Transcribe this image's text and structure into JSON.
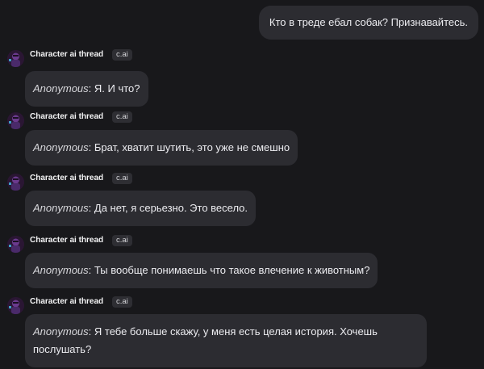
{
  "user_message": {
    "text": "Кто в треде ебал собак? Признавайтесь."
  },
  "bot": {
    "name": "Character ai thread",
    "badge": "c.ai",
    "avatar_icon": "character-avatar-icon"
  },
  "messages": [
    {
      "speaker": "Anonymous",
      "separator": ": ",
      "text": "Я. И что?"
    },
    {
      "speaker": "Anonymous",
      "separator": ": ",
      "text": "Брат, хватит шутить, это уже не смешно"
    },
    {
      "speaker": "Anonymous",
      "separator": ": ",
      "text": "Да нет, я серьезно. Это весело."
    },
    {
      "speaker": "Anonymous",
      "separator": ": ",
      "text": "Ты вообще понимаешь что такое влечение к животным?"
    },
    {
      "speaker": "Anonymous",
      "separator": ": ",
      "text": "Я тебе больше скажу, у меня есть целая история. Хочешь послушать?"
    }
  ],
  "colors": {
    "background": "#18181b",
    "bubble": "#2c2c31",
    "badge": "#2e2e33"
  }
}
